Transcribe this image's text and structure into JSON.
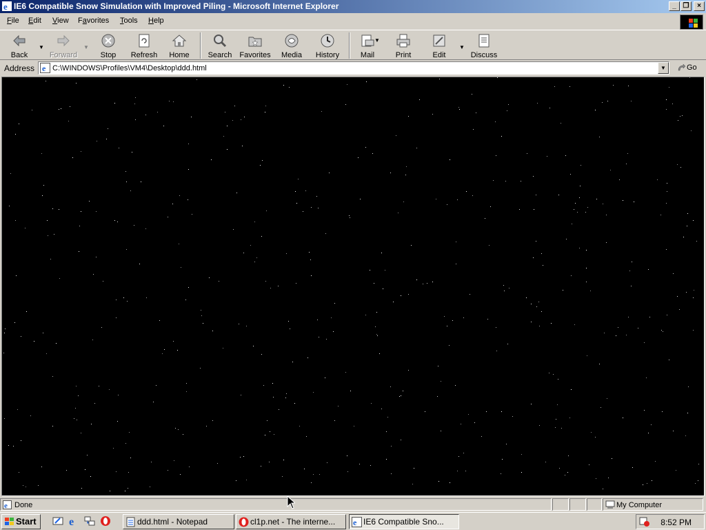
{
  "window": {
    "title": "IE6 Compatible Snow Simulation with Improved Piling - Microsoft Internet Explorer",
    "controls": [
      "_",
      "❐",
      "×"
    ]
  },
  "menu": {
    "items": [
      {
        "label": "File",
        "accel": "F"
      },
      {
        "label": "Edit",
        "accel": "E"
      },
      {
        "label": "View",
        "accel": "V"
      },
      {
        "label": "Favorites",
        "accel": "a"
      },
      {
        "label": "Tools",
        "accel": "T"
      },
      {
        "label": "Help",
        "accel": "H"
      }
    ]
  },
  "toolbar": {
    "back": "Back",
    "forward": "Forward",
    "stop": "Stop",
    "refresh": "Refresh",
    "home": "Home",
    "search": "Search",
    "favorites": "Favorites",
    "media": "Media",
    "history": "History",
    "mail": "Mail",
    "print": "Print",
    "edit": "Edit",
    "discuss": "Discuss"
  },
  "address": {
    "label": "Address",
    "url": "C:\\WINDOWS\\Profiles\\VM4\\Desktop\\ddd.html",
    "go": "Go"
  },
  "content": {
    "background": "#000000",
    "flake_color": "#ffffff"
  },
  "status": {
    "text": "Done",
    "zone": "My Computer"
  },
  "taskbar": {
    "start": "Start",
    "tasks": [
      {
        "label": "ddd.html - Notepad",
        "active": false
      },
      {
        "label": "cl1p.net - The interne...",
        "active": false
      },
      {
        "label": "IE6 Compatible Sno...",
        "active": true
      }
    ],
    "clock": "8:52 PM"
  }
}
